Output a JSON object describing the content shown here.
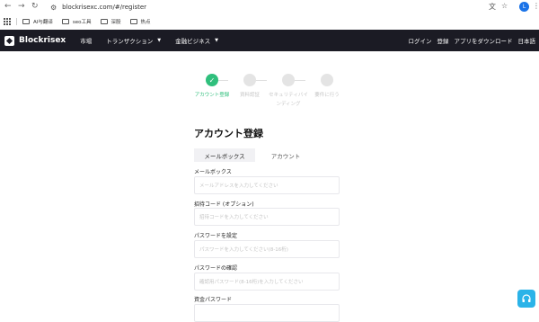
{
  "browser": {
    "url": "blockrisexc.com/#/register",
    "profile_initial": "L",
    "bookmarks": [
      {
        "label": "AI与翻译"
      },
      {
        "label": "seo工具"
      },
      {
        "label": "深股"
      },
      {
        "label": "热点"
      }
    ]
  },
  "site": {
    "brand": "Blockrisex",
    "menu": [
      {
        "label": "市場",
        "has_caret": false
      },
      {
        "label": "トランザクション",
        "has_caret": true
      },
      {
        "label": "金融ビジネス",
        "has_caret": true
      }
    ],
    "nav_right": [
      "ログイン",
      "登録",
      "アプリをダウンロード",
      "日本語"
    ]
  },
  "stepper": {
    "steps": [
      {
        "label": "アカウント登録",
        "status": "done"
      },
      {
        "label": "資料認証",
        "status": "pending"
      },
      {
        "label": "セキュリティバインディング",
        "status": "pending"
      },
      {
        "label": "要件に行う",
        "status": "pending"
      }
    ]
  },
  "form": {
    "title": "アカウント登録",
    "tabs": [
      "メールボックス",
      "アカウント"
    ],
    "fields": [
      {
        "label": "メールボックス",
        "placeholder": "メールアドレスを入力してください"
      },
      {
        "label": "招待コード (オプション)",
        "placeholder": "招待コードを入力してください"
      },
      {
        "label": "パスワードを設定",
        "placeholder": "パスワードを入力してください(8-16桁)"
      },
      {
        "label": "パスワードの確認",
        "placeholder": "確認用パスワード(8-16桁)を入力してください"
      },
      {
        "label": "資金パスワード",
        "placeholder": ""
      }
    ]
  },
  "colors": {
    "navbar_bg": "#1b1b24",
    "accent_green": "#2fbf7c",
    "support_blue": "#2bb3e8"
  }
}
